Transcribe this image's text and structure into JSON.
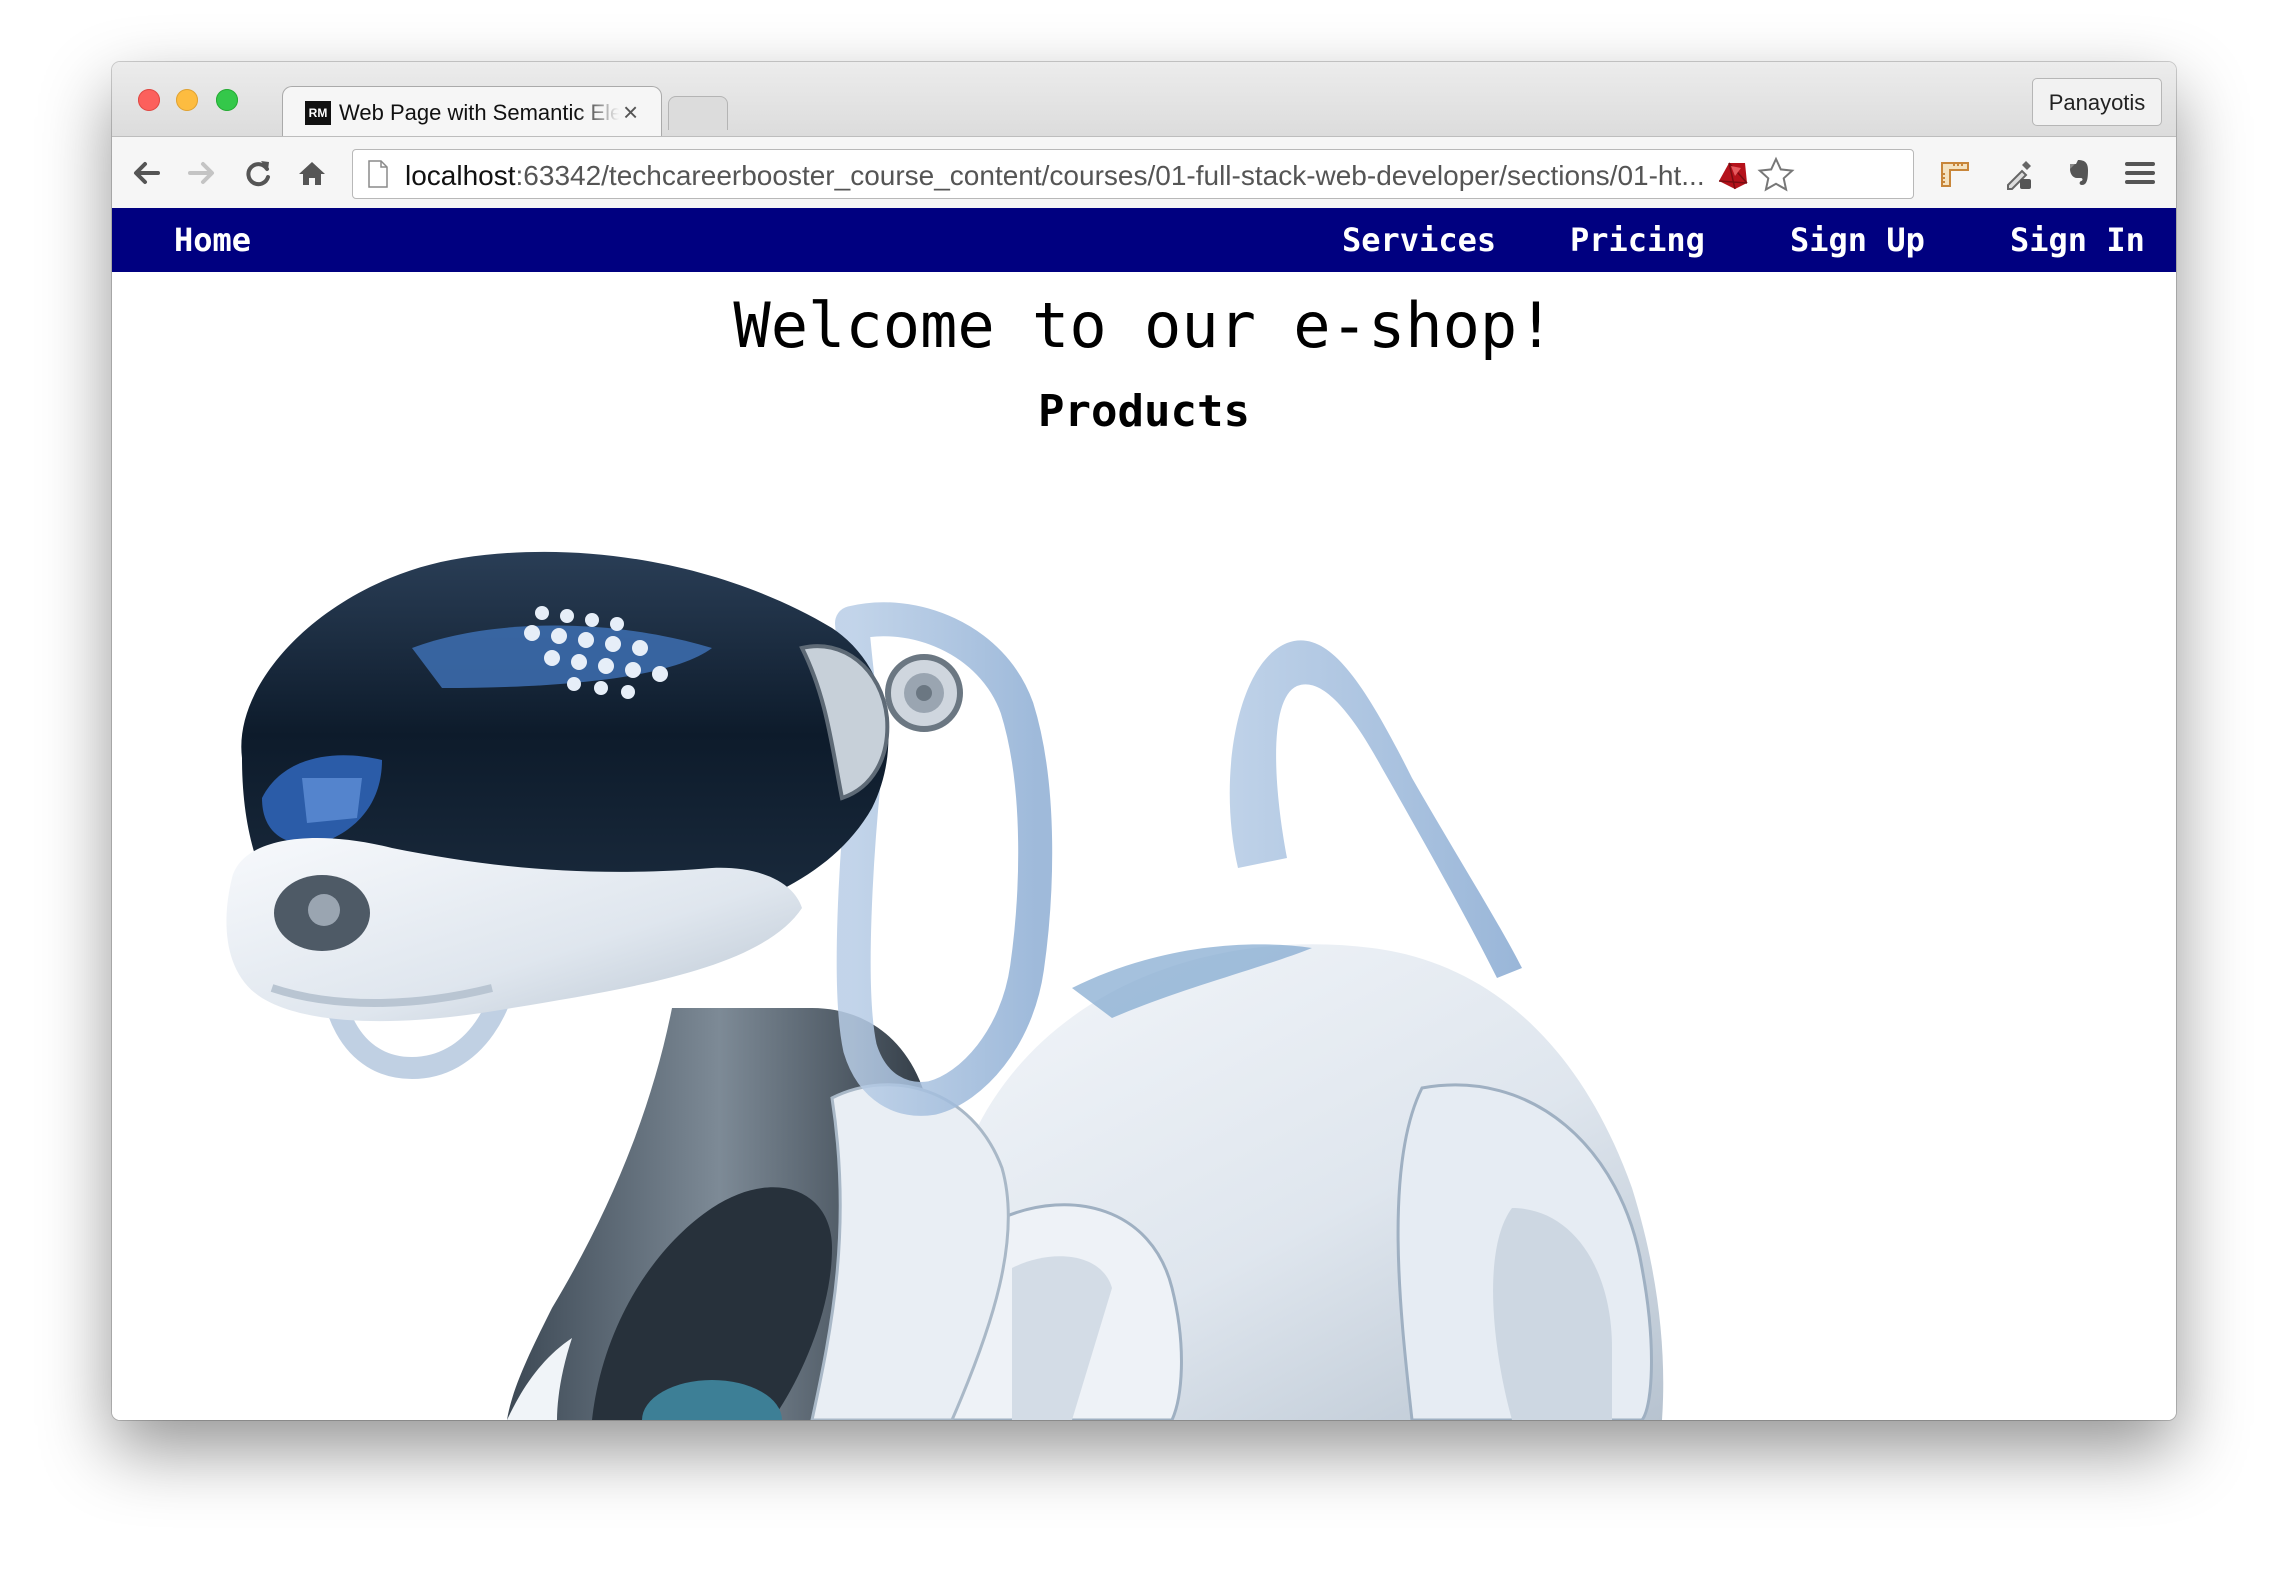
{
  "browser": {
    "tab_title": "Web Page with Semantic Elements",
    "tab_favicon_text": "RM",
    "tab_close_glyph": "×",
    "profile_name": "Panayotis",
    "url_host": "localhost",
    "url_path": ":63342/techcareerbooster_course_content/courses/01-full-stack-web-developer/sections/01-ht...",
    "toolbar_icons": [
      "back-icon",
      "forward-icon",
      "reload-icon",
      "home-icon",
      "ruby-icon",
      "star-icon",
      "ruler-icon",
      "eyedropper-icon",
      "evernote-icon",
      "menu-icon"
    ]
  },
  "nav": {
    "home": "Home",
    "services": "Services",
    "pricing": "Pricing",
    "sign_up": "Sign Up",
    "sign_in": "Sign In",
    "background": "#000080"
  },
  "main": {
    "heading": "Welcome to our e-shop!",
    "subheading": "Products",
    "image_subject": "white robot dog"
  }
}
